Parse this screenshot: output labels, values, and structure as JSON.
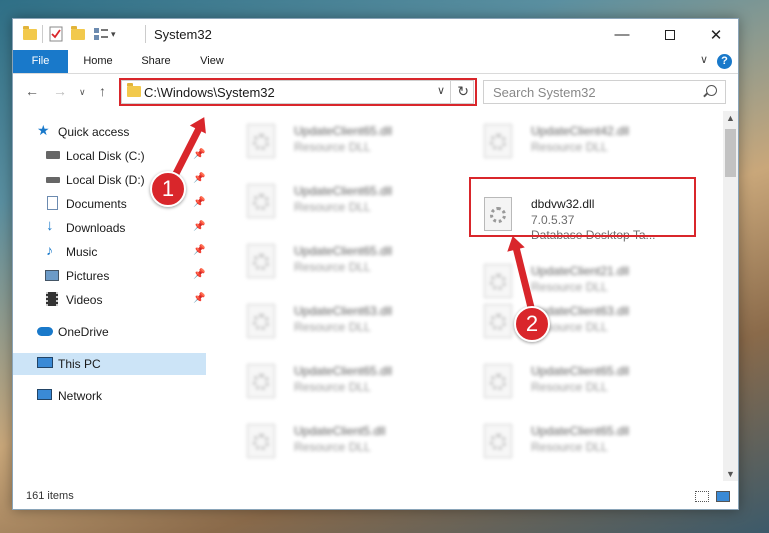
{
  "window": {
    "title": "System32",
    "quick_access_toolbar": [
      "folder-icon",
      "properties-icon",
      "new-folder-icon",
      "view-icon",
      "customize-icon"
    ],
    "controls": [
      "minimize-icon",
      "maximize-icon",
      "close-icon"
    ]
  },
  "ribbon": {
    "tabs": [
      {
        "label": "File"
      },
      {
        "label": "Home"
      },
      {
        "label": "Share"
      },
      {
        "label": "View"
      }
    ],
    "help": "?"
  },
  "nav": {
    "address": "C:\\Windows\\System32",
    "search_placeholder": "Search System32"
  },
  "sidebar": {
    "items": [
      {
        "label": "Quick access",
        "icon": "star-icon"
      },
      {
        "label": "Local Disk (C:)",
        "icon": "drive-icon",
        "pinned": true
      },
      {
        "label": "Local Disk (D:)",
        "icon": "drive-icon",
        "pinned": true
      },
      {
        "label": "Documents",
        "icon": "documents-icon",
        "pinned": true
      },
      {
        "label": "Downloads",
        "icon": "downloads-icon",
        "pinned": true
      },
      {
        "label": "Music",
        "icon": "music-icon",
        "pinned": true
      },
      {
        "label": "Pictures",
        "icon": "pictures-icon",
        "pinned": true
      },
      {
        "label": "Videos",
        "icon": "videos-icon",
        "pinned": true
      },
      {
        "label": "OneDrive",
        "icon": "cloud-icon"
      },
      {
        "label": "This PC",
        "icon": "computer-icon",
        "selected": true
      },
      {
        "label": "Network",
        "icon": "network-icon"
      }
    ]
  },
  "files": {
    "left": [
      {
        "name": "UpdateClient65.dll",
        "type": "Resource DLL"
      },
      {
        "name": "UpdateClient65.dll",
        "type": "Resource DLL"
      },
      {
        "name": "UpdateClient65.dll",
        "type": "Resource DLL"
      },
      {
        "name": "UpdateClient63.dll",
        "type": "Resource DLL"
      },
      {
        "name": "UpdateClient65.dll",
        "type": "Resource DLL"
      },
      {
        "name": "UpdateClient5.dll",
        "type": "Resource DLL"
      }
    ],
    "right": [
      {
        "name": "UpdateClient42.dll",
        "type": "Resource DLL"
      },
      {
        "name": "dbdvw32.dll",
        "version": "7.0.5.37",
        "type": "Database Desktop Ta...",
        "highlighted": true
      },
      {
        "name": "UpdateClient21.dll",
        "type": "Resource DLL"
      },
      {
        "name": "UpdateClient63.dll",
        "type": "Resource DLL"
      },
      {
        "name": "UpdateClient65.dll",
        "type": "Resource DLL"
      },
      {
        "name": "UpdateClient65.dll",
        "type": "Resource DLL"
      }
    ]
  },
  "status": {
    "count": "161 items"
  },
  "callouts": [
    "1",
    "2"
  ],
  "colors": {
    "accent": "#1979ca",
    "highlight": "#d9262b",
    "selected_bg": "#cce4f7"
  }
}
